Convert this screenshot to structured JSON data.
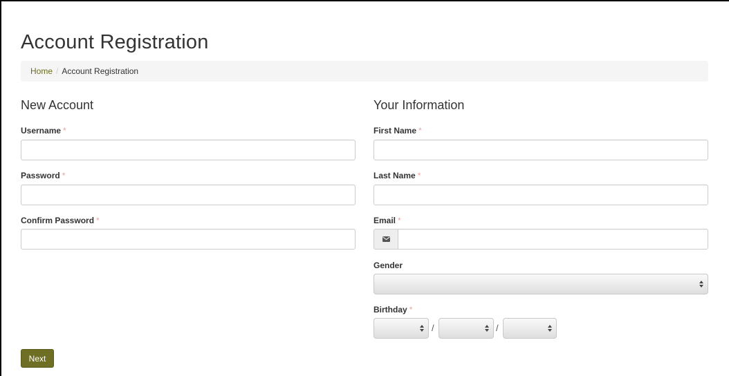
{
  "page": {
    "title": "Account Registration"
  },
  "breadcrumb": {
    "home": "Home",
    "separator": "/",
    "current": "Account Registration"
  },
  "left_section": {
    "title": "New Account",
    "fields": {
      "username": {
        "label": "Username",
        "required_mark": "*",
        "value": ""
      },
      "password": {
        "label": "Password",
        "required_mark": "*",
        "value": ""
      },
      "confirm_password": {
        "label": "Confirm Password",
        "required_mark": "*",
        "value": ""
      }
    }
  },
  "right_section": {
    "title": "Your Information",
    "fields": {
      "first_name": {
        "label": "First Name",
        "required_mark": "*",
        "value": ""
      },
      "last_name": {
        "label": "Last Name",
        "required_mark": "*",
        "value": ""
      },
      "email": {
        "label": "Email",
        "required_mark": "*",
        "value": "",
        "icon": "envelope-icon"
      },
      "gender": {
        "label": "Gender",
        "selected": ""
      },
      "birthday": {
        "label": "Birthday",
        "required_mark": "*",
        "separator": "/",
        "selected": [
          "",
          "",
          ""
        ]
      }
    }
  },
  "actions": {
    "next_label": "Next"
  },
  "colors": {
    "accent": "#6e6e24",
    "link": "#6b6b22",
    "required": "#e8a3a3",
    "breadcrumb_bg": "#f5f5f5"
  }
}
